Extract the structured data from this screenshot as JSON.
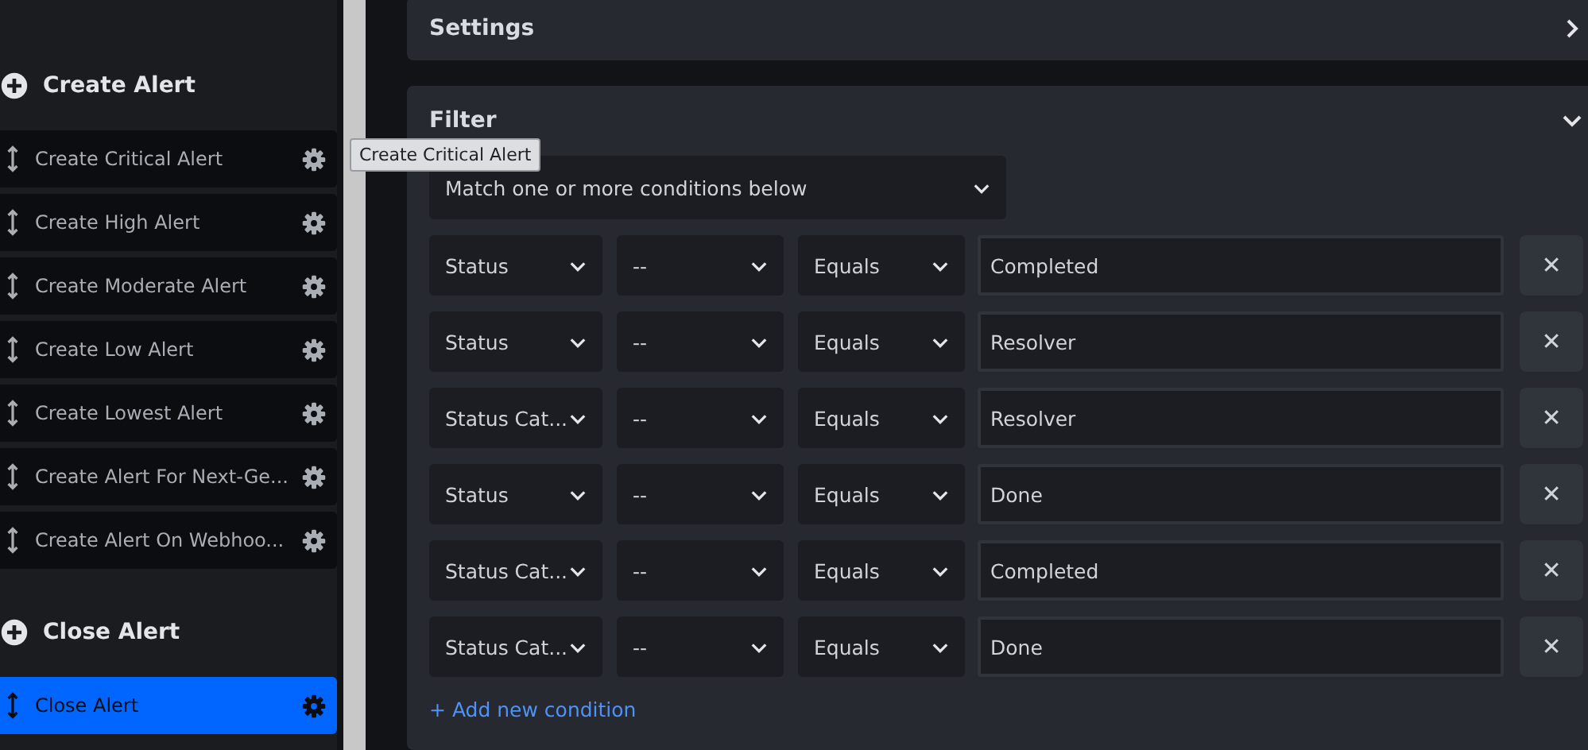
{
  "sidebar": {
    "groups": [
      {
        "title": "Create Alert",
        "items": [
          {
            "label": "Create Critical Alert",
            "selected": false
          },
          {
            "label": "Create High Alert",
            "selected": false
          },
          {
            "label": "Create Moderate Alert",
            "selected": false
          },
          {
            "label": "Create Low Alert",
            "selected": false
          },
          {
            "label": "Create Lowest Alert",
            "selected": false
          },
          {
            "label": "Create Alert For Next-Ge...",
            "selected": false
          },
          {
            "label": "Create Alert On Webhoo...",
            "selected": false
          }
        ]
      },
      {
        "title": "Close Alert",
        "items": [
          {
            "label": "Close Alert",
            "selected": true
          }
        ]
      }
    ]
  },
  "tooltip": "Create Critical Alert",
  "panels": [
    {
      "kind": "settings",
      "title": "Settings",
      "expanded": false
    },
    {
      "kind": "filter",
      "title": "Filter",
      "expanded": true,
      "match": "Match one or more conditions below",
      "conditions": [
        {
          "field": "Status",
          "operator_1": "--",
          "operator_2": "Equals",
          "value": "Completed",
          "remove": "✕"
        },
        {
          "field": "Status",
          "operator_1": "--",
          "operator_2": "Equals",
          "value": "Resolver",
          "remove": "✕"
        },
        {
          "field": "Status Cat...",
          "operator_1": "--",
          "operator_2": "Equals",
          "value": "Resolver",
          "remove": "✕"
        },
        {
          "field": "Status",
          "operator_1": "--",
          "operator_2": "Equals",
          "value": "Done",
          "remove": "✕"
        },
        {
          "field": "Status Cat...",
          "operator_1": "--",
          "operator_2": "Equals",
          "value": "Completed",
          "remove": "✕"
        },
        {
          "field": "Status Cat...",
          "operator_1": "--",
          "operator_2": "Equals",
          "value": "Done",
          "remove": "✕"
        }
      ],
      "add_link": "+ Add new condition"
    }
  ]
}
